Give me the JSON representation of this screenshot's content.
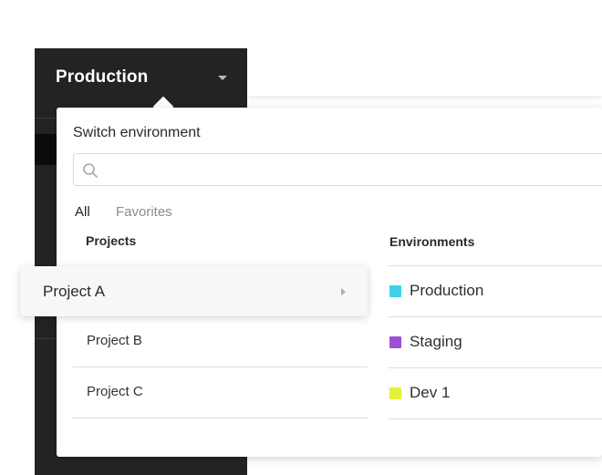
{
  "sidebar": {
    "title": "Production"
  },
  "switcher": {
    "title": "Switch environment",
    "search": {
      "value": "",
      "placeholder": ""
    },
    "tabs": [
      {
        "label": "All",
        "active": true
      },
      {
        "label": "Favorites",
        "active": false
      }
    ],
    "projects_header": "Projects",
    "environments_header": "Environments",
    "projects": [
      {
        "label": "Project A",
        "selected": true
      },
      {
        "label": "Project B",
        "selected": false
      },
      {
        "label": "Project C",
        "selected": false
      }
    ],
    "environments": [
      {
        "label": "Production",
        "color": "#3fd0ee"
      },
      {
        "label": "Staging",
        "color": "#9c4fd8"
      },
      {
        "label": "Dev 1",
        "color": "#e3f03c"
      }
    ]
  }
}
